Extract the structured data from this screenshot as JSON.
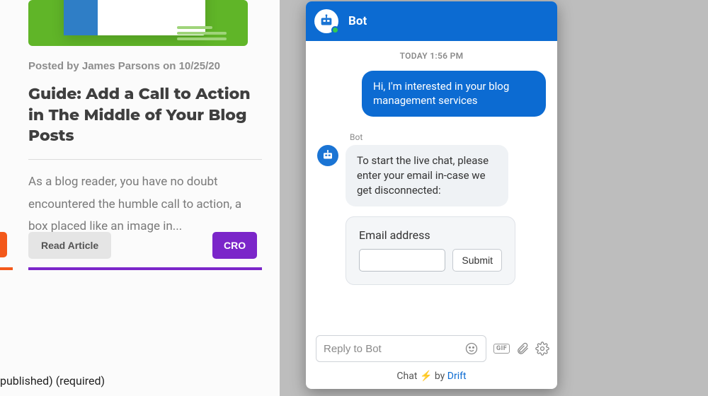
{
  "blog": {
    "posted_by": "Posted by James Parsons on 10/25/20",
    "title": "Guide: Add a Call to Action in The Middle of Your Blog Posts",
    "excerpt": "As a blog reader, you have no doubt encountered the humble call to action, a box placed like an image in...",
    "read_label": "Read Article",
    "cro_label": "CRO",
    "footer_fragment": "published) (required)"
  },
  "chat": {
    "header_name": "Bot",
    "timestamp": "TODAY 1:56 PM",
    "user_message": "Hi, I'm interested in your blog management services",
    "bot_sender": "Bot",
    "bot_message": "To start the live chat, please enter your email in-case we get disconnected:",
    "email_label": "Email address",
    "submit_label": "Submit",
    "reply_placeholder": "Reply to Bot",
    "gif_label": "GIF",
    "footer_prefix": "Chat",
    "footer_by": "by",
    "footer_brand": "Drift"
  }
}
